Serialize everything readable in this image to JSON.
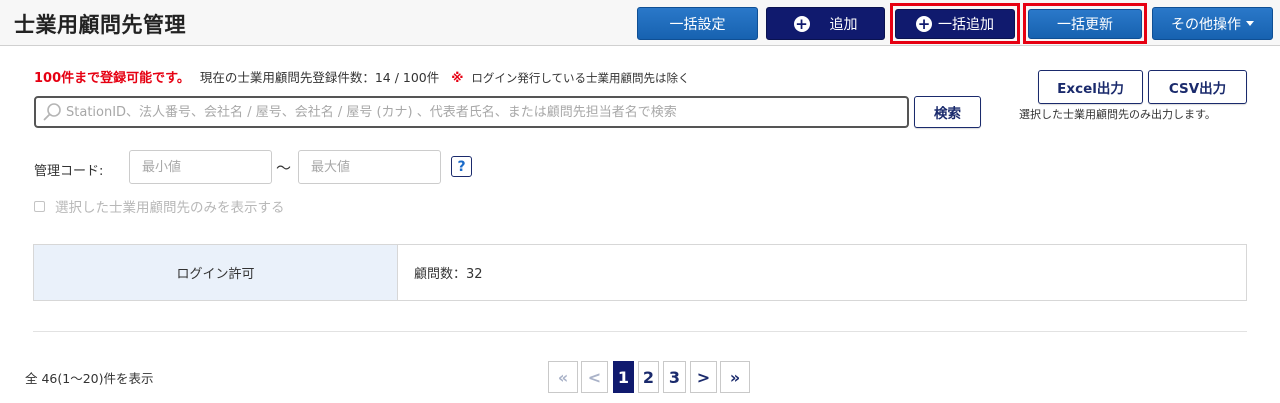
{
  "header": {
    "title": "士業用顧問先管理",
    "buttons": {
      "bulk_settings": "一括設定",
      "add": "追加",
      "bulk_add": "一括追加",
      "bulk_update": "一括更新",
      "other_ops": "その他操作"
    },
    "highlight_color": "#e60012"
  },
  "limit": {
    "max_text": "100件まで登録可能です。",
    "count_text": "現在の士業用顧問先登録件数：14 / 100件",
    "kome": "※",
    "note": "ログイン発行している士業用顧問先は除く"
  },
  "search": {
    "placeholder": "StationID、法人番号、会社名 / 屋号、会社名 / 屋号 (カナ) 、代表者氏名、または顧問先担当者名で検索",
    "value": "",
    "button_label": "検索"
  },
  "export": {
    "excel_label": "Excel出力",
    "csv_label": "CSV出力",
    "note": "選択した士業用顧問先のみ出力します。"
  },
  "filter": {
    "code_label": "管理コード:",
    "min_placeholder": "最小値",
    "max_placeholder": "最大値",
    "tilde": "～",
    "help": "?",
    "only_selected_label": "選択した士業用顧問先のみを表示する"
  },
  "summary": {
    "label": "ログイン許可",
    "value": "顧問数：32"
  },
  "pagination": {
    "total_text": "全 46(1～20)件を表示",
    "first": "«",
    "prev": "<",
    "pages": [
      "1",
      "2",
      "3"
    ],
    "current": "1",
    "next": ">",
    "last": "»"
  }
}
